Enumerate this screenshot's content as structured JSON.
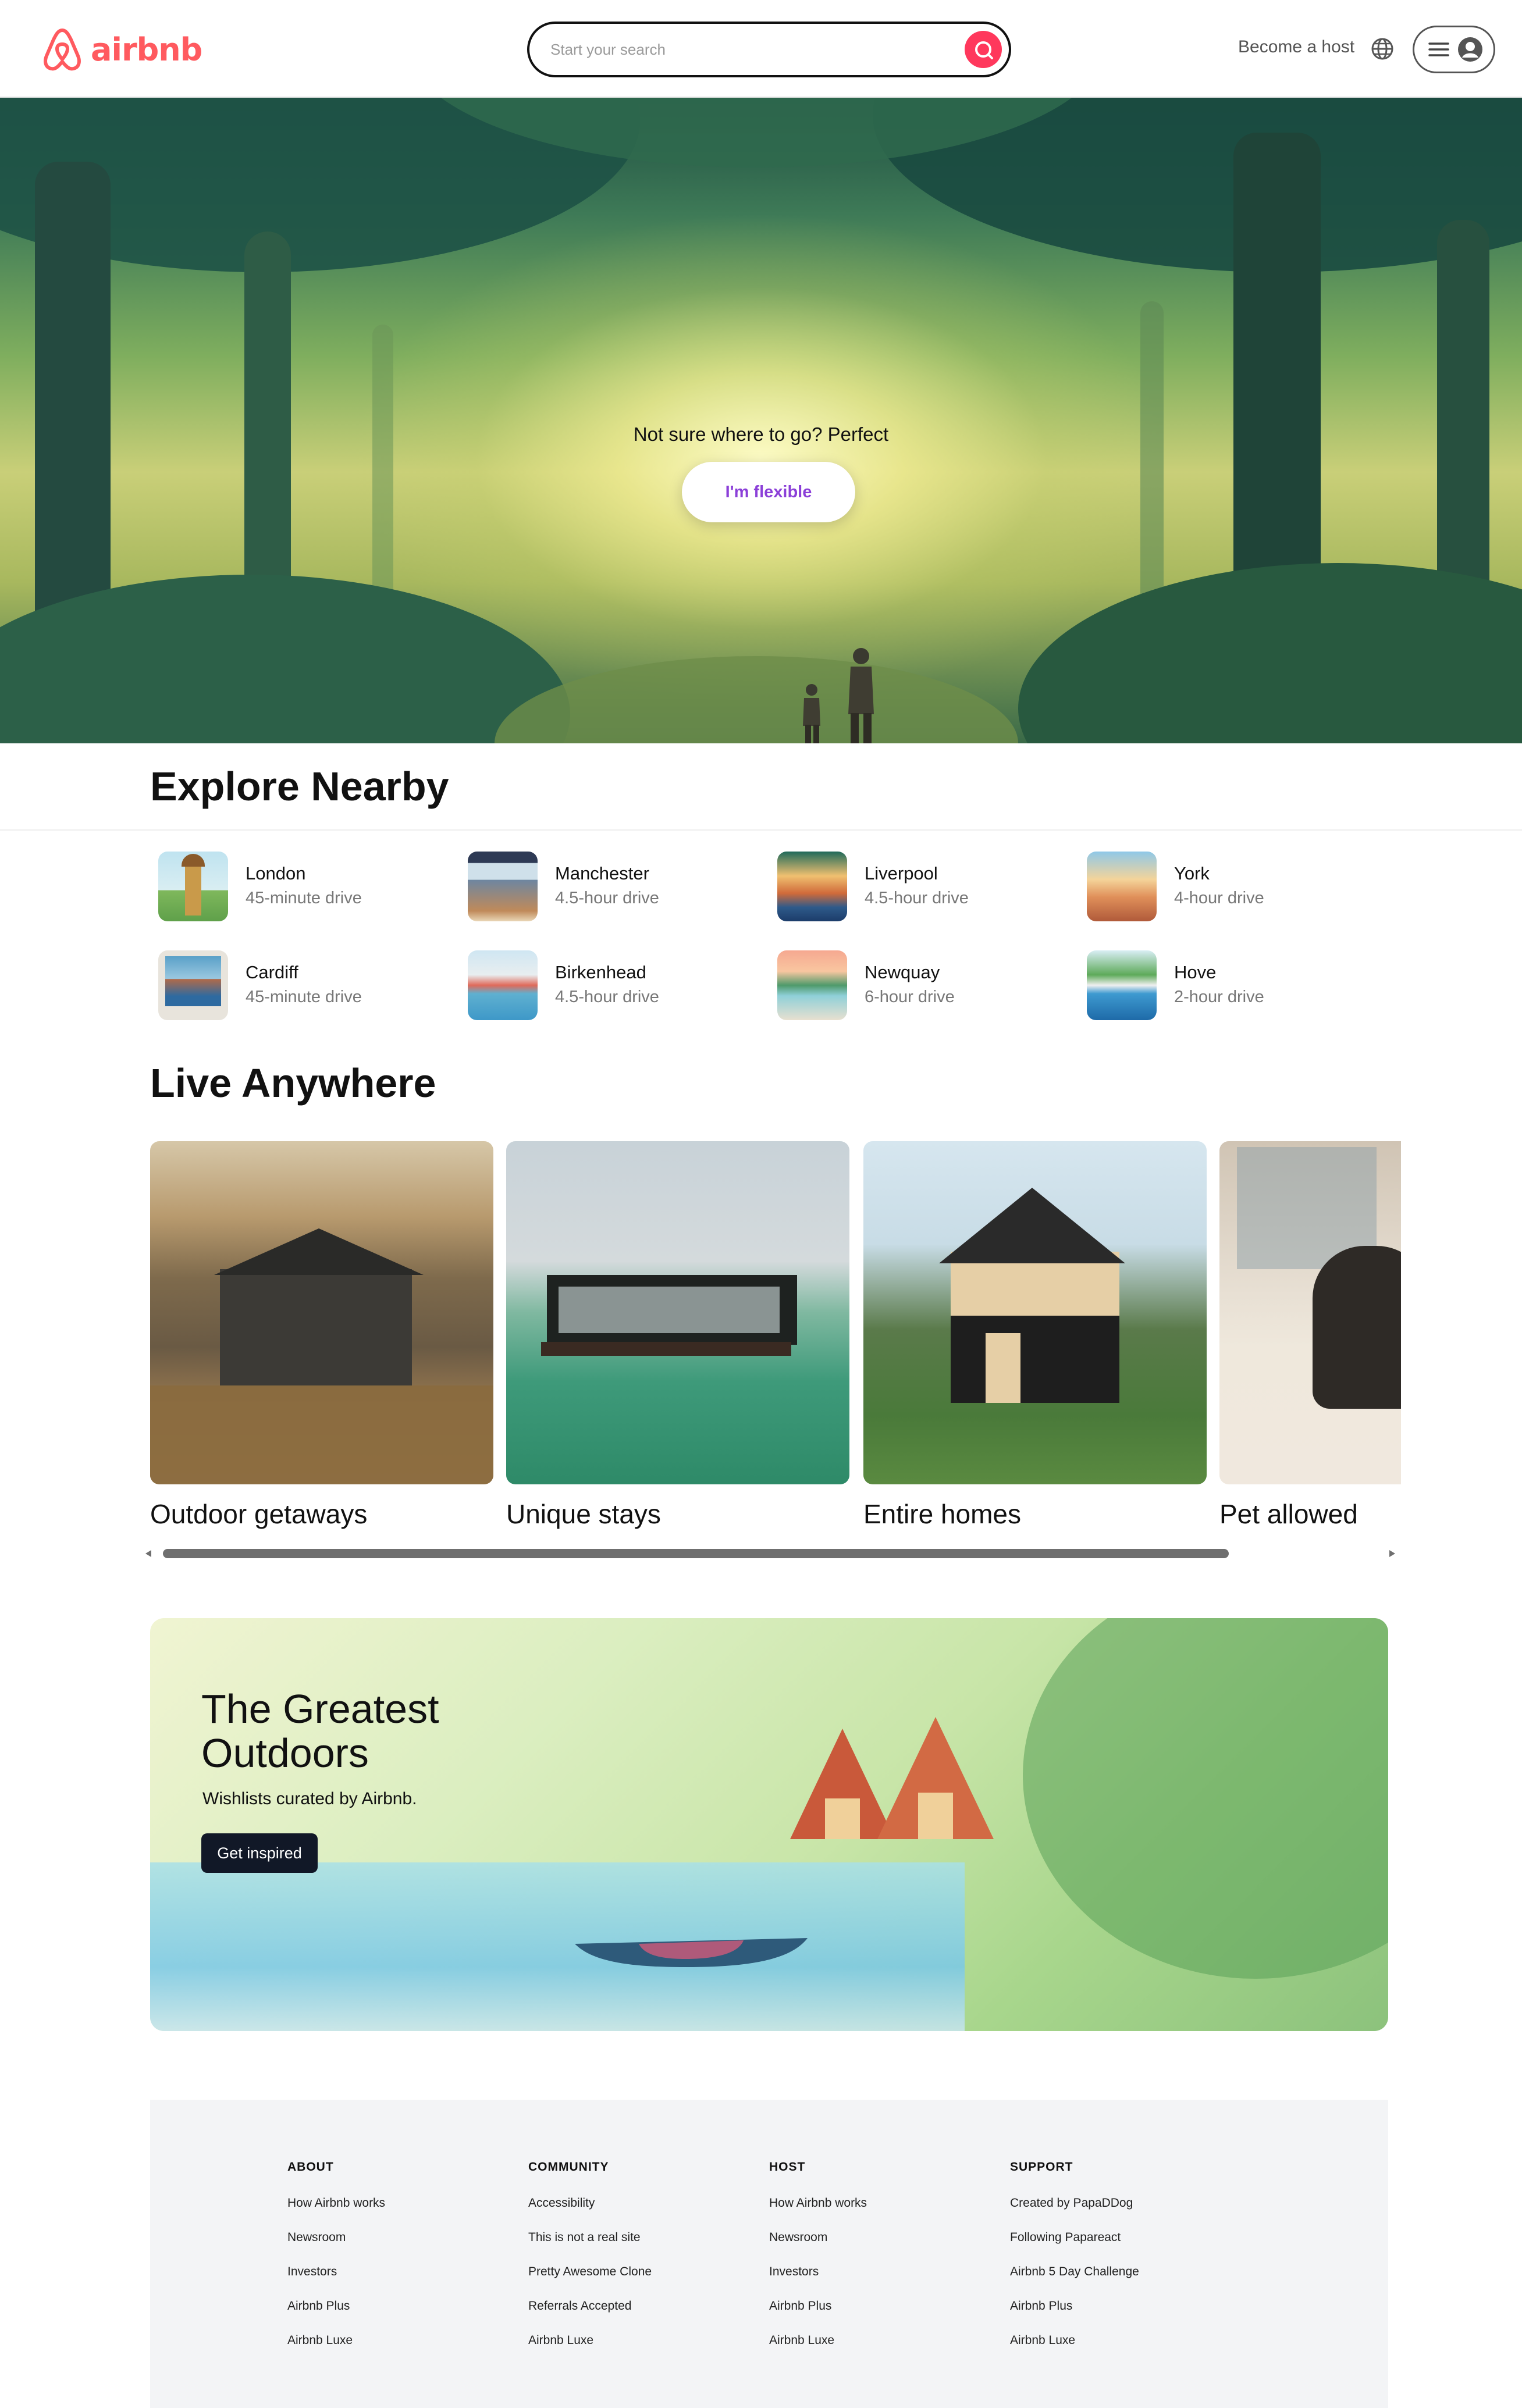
{
  "header": {
    "logo_text": "airbnb",
    "search_placeholder": "Start your search",
    "host_link": "Become a host",
    "brand_color": "#ff5a5f",
    "search_button_color": "#ff385c"
  },
  "hero": {
    "tagline": "Not sure where to go? Perfect",
    "cta_label": "I'm flexible",
    "cta_color": "#8b3fd8"
  },
  "explore": {
    "title": "Explore Nearby",
    "places": [
      {
        "name": "London",
        "distance": "45-minute drive"
      },
      {
        "name": "Manchester",
        "distance": "4.5-hour drive"
      },
      {
        "name": "Liverpool",
        "distance": "4.5-hour drive"
      },
      {
        "name": "York",
        "distance": "4-hour drive"
      },
      {
        "name": "Cardiff",
        "distance": "45-minute drive"
      },
      {
        "name": "Birkenhead",
        "distance": "4.5-hour drive"
      },
      {
        "name": "Newquay",
        "distance": "6-hour drive"
      },
      {
        "name": "Hove",
        "distance": "2-hour drive"
      }
    ]
  },
  "live": {
    "title": "Live Anywhere",
    "cards": [
      {
        "title": "Outdoor getaways"
      },
      {
        "title": "Unique stays"
      },
      {
        "title": "Entire homes"
      },
      {
        "title": "Pet allowed"
      }
    ]
  },
  "banner": {
    "title": "The Greatest Outdoors",
    "subtitle": "Wishlists curated by Airbnb.",
    "cta_label": "Get inspired"
  },
  "footer": {
    "columns": [
      {
        "heading": "ABOUT",
        "links": [
          "How Airbnb works",
          "Newsroom",
          "Investors",
          "Airbnb Plus",
          "Airbnb Luxe"
        ]
      },
      {
        "heading": "COMMUNITY",
        "links": [
          "Accessibility",
          "This is not a real site",
          "Pretty Awesome Clone",
          "Referrals Accepted",
          "Airbnb Luxe"
        ]
      },
      {
        "heading": "HOST",
        "links": [
          "How Airbnb works",
          "Newsroom",
          "Investors",
          "Airbnb Plus",
          "Airbnb Luxe"
        ]
      },
      {
        "heading": "SUPPORT",
        "links": [
          "Created by PapaDDog",
          "Following Papareact",
          "Airbnb 5 Day Challenge",
          "Airbnb Plus",
          "Airbnb Luxe"
        ]
      }
    ]
  }
}
